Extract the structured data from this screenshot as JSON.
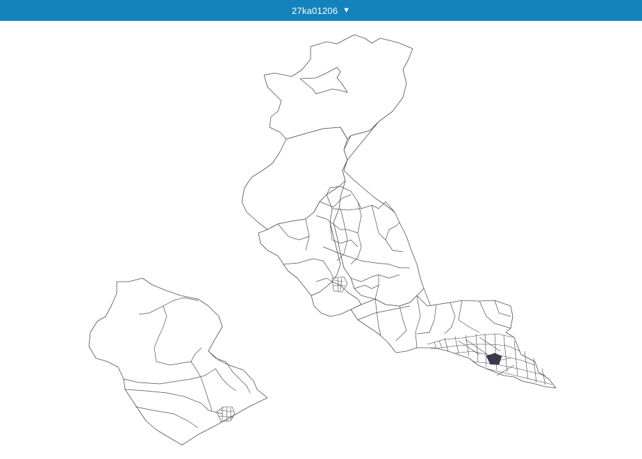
{
  "header": {
    "title": "27ka01206",
    "caret": "▼",
    "bg_color": "#1483bb",
    "text_color": "#ffffff"
  },
  "map": {
    "background": "#ffffff",
    "line_color": "#4a4a5a"
  }
}
